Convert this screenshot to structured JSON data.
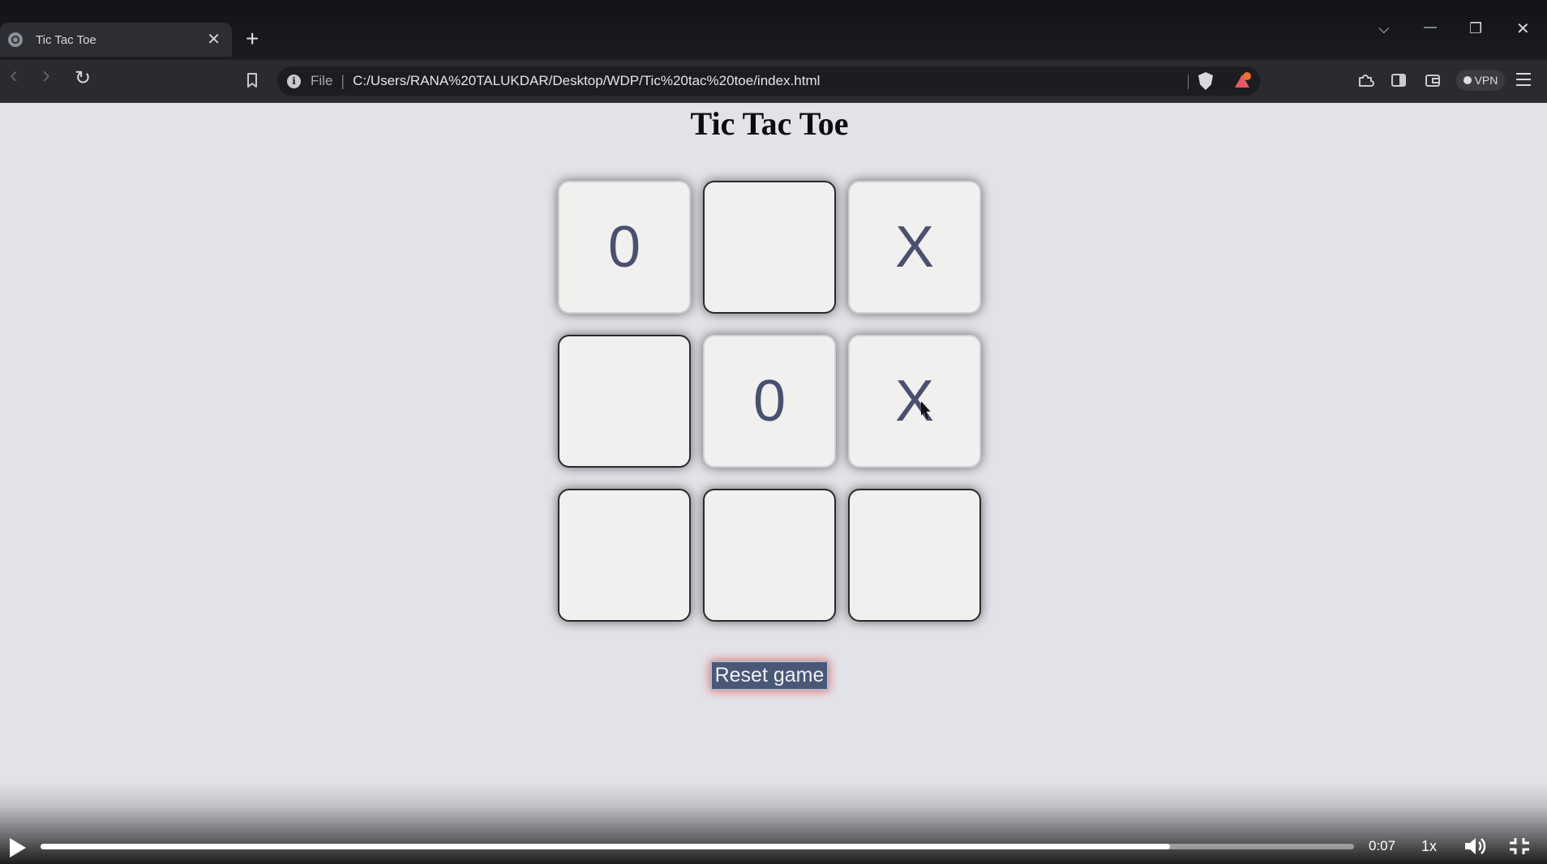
{
  "browser": {
    "tab": {
      "title": "Tic Tac Toe",
      "close_glyph": "✕",
      "favicon_icon": "globe-icon"
    },
    "new_tab_glyph": "+",
    "window_controls": {
      "dropdown": "⌵",
      "minimize": "—",
      "restore": "❐",
      "close": "✕"
    },
    "nav": {
      "back": "‹",
      "forward": "›",
      "reload": "↻"
    },
    "address": {
      "scheme_label": "File",
      "separator": "|",
      "url": "C:/Users/RANA%20TALUKDAR/Desktop/WDP/Tic%20tac%20toe/index.html"
    },
    "vpn_label": "VPN"
  },
  "page": {
    "title": "Tic Tac Toe",
    "board": [
      [
        "0",
        "",
        "X"
      ],
      [
        "",
        "0",
        "X"
      ],
      [
        "",
        "",
        ""
      ]
    ],
    "reset_label": "Reset game",
    "colors": {
      "mark": "#4a5070",
      "reset_bg": "#4a5878",
      "reset_glow": "#e84646"
    }
  },
  "player": {
    "time": "0:07",
    "speed": "1x",
    "progress": 0.86
  }
}
